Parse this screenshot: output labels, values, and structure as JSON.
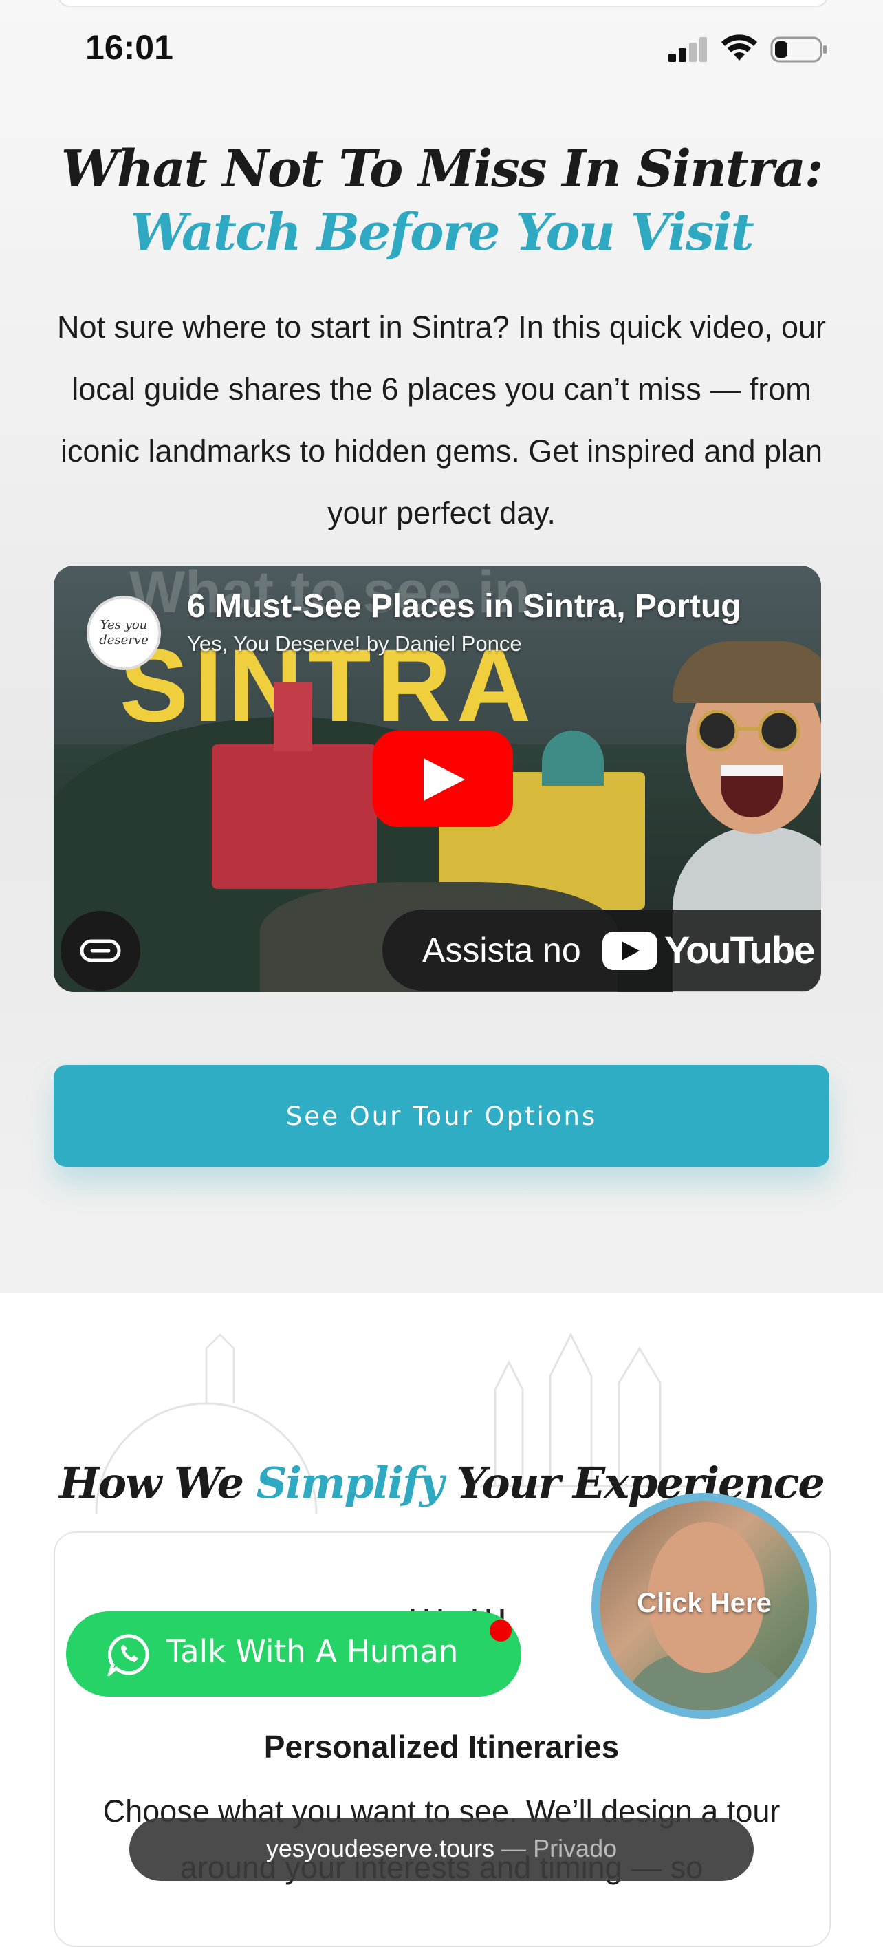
{
  "status_bar": {
    "time": "16:01"
  },
  "hero": {
    "title_dark": "What Not To Miss In Sintra: ",
    "title_accent": "Watch Before You Visit",
    "intro": "Not sure where to start in Sintra? In this quick video, our local guide shares the 6 places you can’t miss — from iconic landmarks to hidden gems. Get inspired and plan your perfect day."
  },
  "video": {
    "title": "6 Must-See Places in Sintra, Portug",
    "channel": "Yes, You Deserve! by Daniel Ponce",
    "channel_avatar_text": "Yes you deserve",
    "thumbnail_overlay_text": "What to see in",
    "thumbnail_big_text": "SINTRA",
    "watch_on_label": "Assista no",
    "youtube_wordmark": "YouTube",
    "play_icon": "play-icon",
    "link_icon": "link-icon"
  },
  "cta": {
    "label": "See Our Tour Options"
  },
  "section2": {
    "title_before": "How We ",
    "title_accent": "Simplify",
    "title_after": " Your Experience",
    "feature_title": "Personalized Itineraries",
    "feature_text": "Choose what you want to see. We’ll design a tour around your interests and timing — so"
  },
  "whatsapp": {
    "label": "Talk With A Human",
    "icon": "whatsapp-icon"
  },
  "video_bubble": {
    "label": "Click Here"
  },
  "browser": {
    "domain": "yesyoudeserve.tours",
    "separator": " — ",
    "mode": "Privado"
  },
  "colors": {
    "accent": "#2fa9c1",
    "cta": "#2eadc4",
    "whatsapp": "#25d366",
    "youtube_red": "#ff0000"
  }
}
